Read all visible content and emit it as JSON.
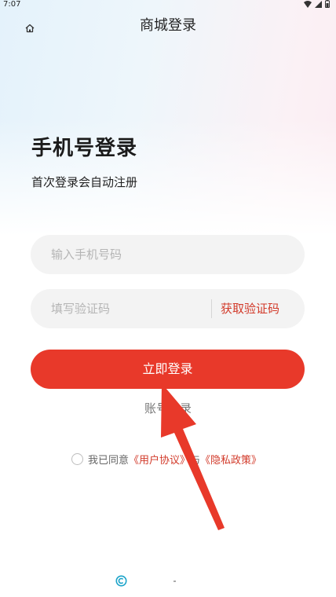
{
  "status_bar": {
    "time": "7:07",
    "icons": [
      "wifi-icon",
      "signal-icon",
      "battery-icon"
    ]
  },
  "nav": {
    "title": "商城登录",
    "home_icon": "home-icon"
  },
  "header": {
    "heading": "手机号登录",
    "subheading": "首次登录会自动注册"
  },
  "form": {
    "phone_placeholder": "输入手机号码",
    "phone_value": "",
    "code_placeholder": "填写验证码",
    "code_value": "",
    "get_code_label": "获取验证码",
    "login_button": "立即登录",
    "account_login": "账号登录"
  },
  "agreement": {
    "checked": false,
    "prefix": "我已同意",
    "user_agreement": "《用户协议》",
    "connector": "与",
    "privacy_policy": "《隐私政策》"
  },
  "colors": {
    "accent": "#e8392a",
    "link": "#d23a2a",
    "input_bg": "#f3f3f3",
    "arrow": "#e8392a"
  }
}
